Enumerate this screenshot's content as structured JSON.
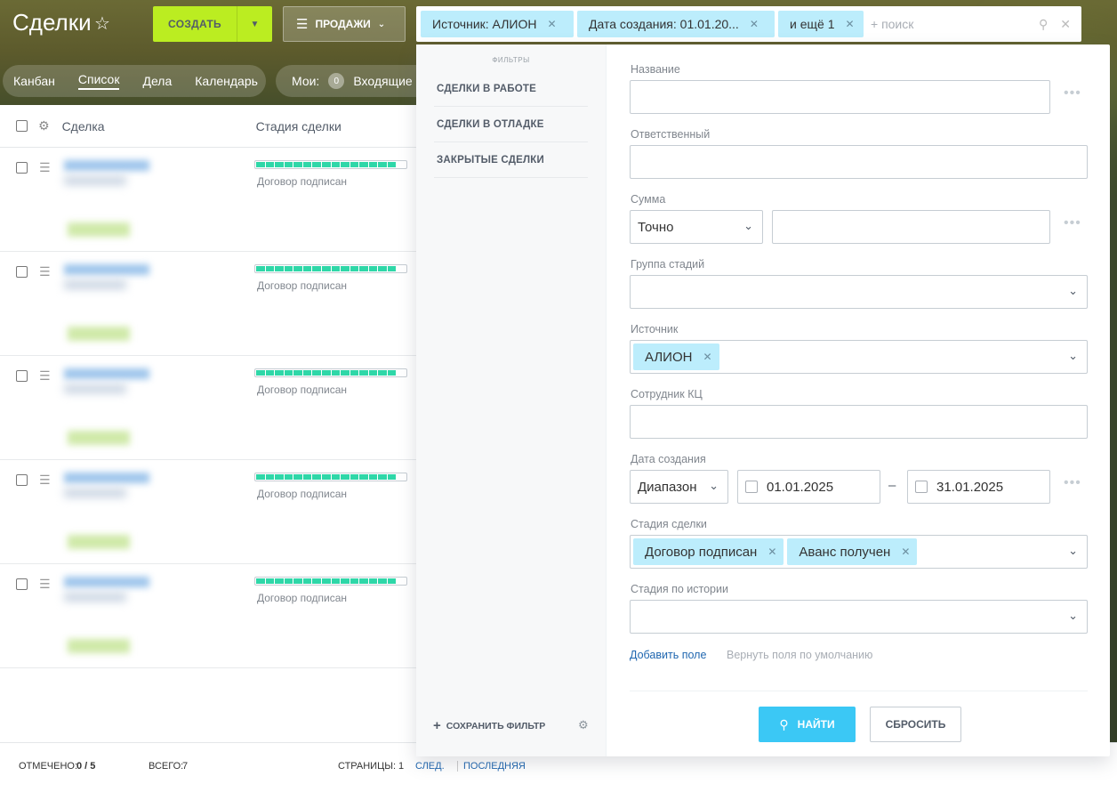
{
  "header": {
    "title": "Сделки",
    "create_label": "СОЗДАТЬ",
    "sales_label": "ПРОДАЖИ",
    "filter_chips": [
      {
        "label": "Источник: АЛИОН"
      },
      {
        "label": "Дата создания: 01.01.20..."
      },
      {
        "label": "и ещё 1"
      }
    ],
    "search_placeholder": "+ поиск"
  },
  "views": [
    "Канбан",
    "Список",
    "Дела",
    "Календарь"
  ],
  "mine": {
    "label": "Мои:",
    "count": "0",
    "incoming": "Входящие"
  },
  "table": {
    "columns": [
      "Сделка",
      "Стадия сделки"
    ],
    "rows": [
      {
        "stage": "Договор подписан",
        "progress": 0.94
      },
      {
        "stage": "Договор подписан",
        "progress": 0.94
      },
      {
        "stage": "Договор подписан",
        "progress": 0.94
      },
      {
        "stage": "Договор подписан",
        "progress": 0.94
      },
      {
        "stage": "Договор подписан",
        "progress": 0.94
      }
    ]
  },
  "footer": {
    "marked_label": "ОТМЕЧЕНО:",
    "marked_value": "0 / 5",
    "total_label": "ВСЕГО:",
    "total_value": "7",
    "pages_label": "СТРАНИЦЫ:",
    "pages_value": "1",
    "next": "СЛЕД.",
    "last": "ПОСЛЕДНЯЯ"
  },
  "filter_popup": {
    "header": "ФИЛЬТРЫ",
    "presets": [
      "СДЕЛКИ В РАБОТЕ",
      "СДЕЛКИ В ОТЛАДКЕ",
      "ЗАКРЫТЫЕ СДЕЛКИ"
    ],
    "save_filter": "СОХРАНИТЬ ФИЛЬТР",
    "fields": {
      "name_label": "Название",
      "responsible_label": "Ответственный",
      "sum_label": "Сумма",
      "sum_mode": "Точно",
      "stage_group_label": "Группа стадий",
      "source_label": "Источник",
      "source_value": "АЛИОН",
      "kc_label": "Сотрудник КЦ",
      "date_label": "Дата создания",
      "date_mode": "Диапазон",
      "date_from": "01.01.2025",
      "date_to": "31.01.2025",
      "date_separator": "–",
      "stage_label": "Стадия сделки",
      "stage_values": [
        "Договор подписан",
        "Аванс получен"
      ],
      "history_label": "Стадия по истории"
    },
    "add_field": "Добавить поле",
    "restore_fields": "Вернуть поля по умолчанию",
    "find": "НАЙТИ",
    "reset": "СБРОСИТЬ"
  },
  "colors": {
    "accent_green": "#bbed21",
    "accent_blue": "#3bc8f5",
    "chip": "#bcedfc",
    "progress": "#2fd7a8"
  }
}
